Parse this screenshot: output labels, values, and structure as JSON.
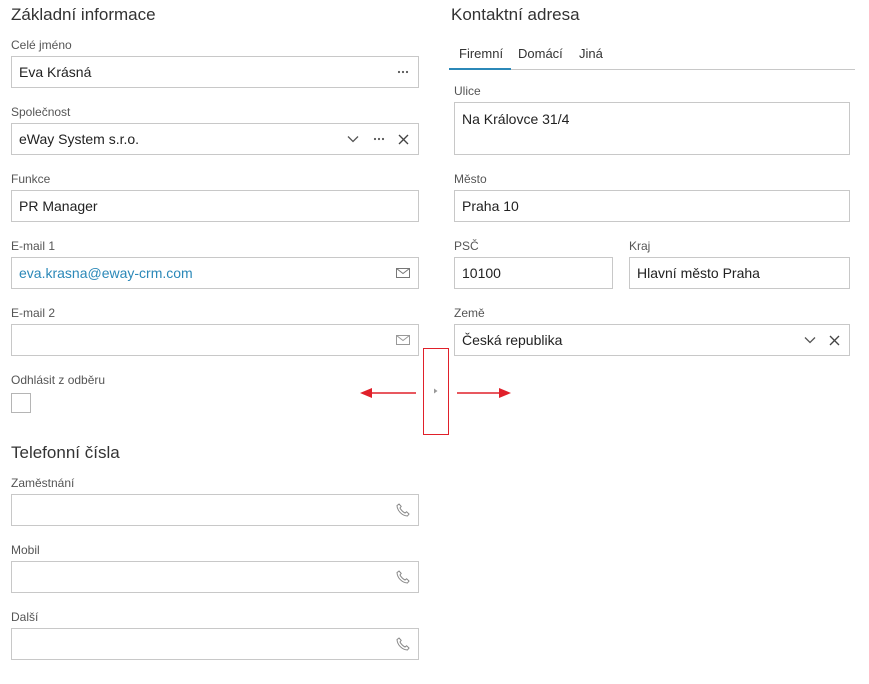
{
  "basic": {
    "title": "Základní informace",
    "full_name_label": "Celé jméno",
    "full_name_value": "Eva Krásná",
    "company_label": "Společnost",
    "company_value": "eWay System s.r.o.",
    "function_label": "Funkce",
    "function_value": "PR Manager",
    "email1_label": "E-mail 1",
    "email1_value": "eva.krasna@eway-crm.com",
    "email2_label": "E-mail 2",
    "email2_value": "",
    "unsubscribe_label": "Odhlásit z odběru"
  },
  "phones": {
    "title": "Telefonní čísla",
    "work_label": "Zaměstnání",
    "work_value": "",
    "mobile_label": "Mobil",
    "mobile_value": "",
    "other_label": "Další",
    "other_value": ""
  },
  "address": {
    "title": "Kontaktní adresa",
    "tabs": [
      {
        "label": "Firemní",
        "active": true
      },
      {
        "label": "Domácí",
        "active": false
      },
      {
        "label": "Jiná",
        "active": false
      }
    ],
    "street_label": "Ulice",
    "street_value": "Na Královce 31/4",
    "city_label": "Město",
    "city_value": "Praha 10",
    "zip_label": "PSČ",
    "zip_value": "10100",
    "region_label": "Kraj",
    "region_value": "Hlavní město Praha",
    "country_label": "Země",
    "country_value": "Česká republika"
  },
  "colors": {
    "accent": "#2b88b8",
    "annotation": "#e0202a",
    "border": "#c8c8c8"
  },
  "icons": [
    "more-icon",
    "chevron-down-icon",
    "close-icon",
    "mail-icon",
    "phone-icon",
    "splitter-arrow-icon"
  ]
}
